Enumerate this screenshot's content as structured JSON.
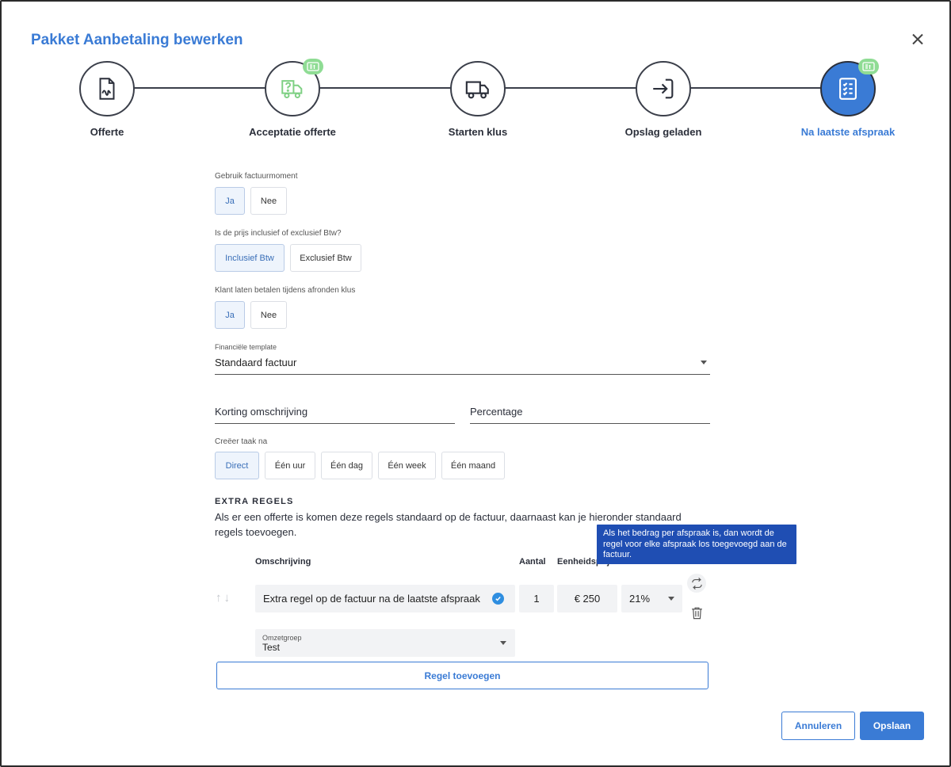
{
  "dialog": {
    "title": "Pakket Aanbetaling bewerken"
  },
  "steps": [
    {
      "label": "Offerte",
      "icon": "document-icon",
      "badge": false,
      "active": false
    },
    {
      "label": "Acceptatie offerte",
      "icon": "truck-question-icon",
      "badge": true,
      "active": false
    },
    {
      "label": "Starten klus",
      "icon": "truck-icon",
      "badge": false,
      "active": false
    },
    {
      "label": "Opslag geladen",
      "icon": "login-arrow-icon",
      "badge": false,
      "active": false
    },
    {
      "label": "Na laatste afspraak",
      "icon": "checklist-icon",
      "badge": true,
      "active": true
    }
  ],
  "form": {
    "factuurmoment": {
      "label": "Gebruik factuurmoment",
      "options": [
        "Ja",
        "Nee"
      ],
      "selected": "Ja"
    },
    "btw": {
      "label": "Is de prijs inclusief of exclusief Btw?",
      "options": [
        "Inclusief Btw",
        "Exclusief Btw"
      ],
      "selected": "Inclusief Btw"
    },
    "betalen": {
      "label": "Klant laten betalen tijdens afronden klus",
      "options": [
        "Ja",
        "Nee"
      ],
      "selected": "Ja"
    },
    "template": {
      "label": "Financiële template",
      "value": "Standaard factuur"
    },
    "korting": {
      "placeholder": "Korting omschrijving"
    },
    "percentage": {
      "placeholder": "Percentage"
    },
    "taak": {
      "label": "Creëer taak na",
      "options": [
        "Direct",
        "Één uur",
        "Één dag",
        "Één week",
        "Één maand"
      ],
      "selected": "Direct"
    }
  },
  "extra": {
    "title": "EXTRA REGELS",
    "description": "Als er een offerte is komen deze regels standaard op de factuur, daarnaast kan je hieronder standaard regels toevoegen.",
    "tooltip": "Als het bedrag per afspraak is, dan wordt de regel voor elke afspraak los toegevoegd aan de factuur.",
    "headers": {
      "omschrijving": "Omschrijving",
      "aantal": "Aantal",
      "eenheidsprijs": "Eenheidsprijs"
    },
    "row": {
      "omschrijving": "Extra regel op de factuur na de laatste afspraak",
      "aantal": "1",
      "prijs": "€ 250",
      "btw": "21%",
      "arrows": "↑↓",
      "omzetgroep_label": "Omzetgroep",
      "omzetgroep_value": "Test"
    },
    "add_label": "Regel toevoegen"
  },
  "footer": {
    "cancel": "Annuleren",
    "save": "Opslaan"
  },
  "colors": {
    "accent": "#3a7bd5",
    "badge": "#8fdc94",
    "tooltip": "#1f4eb3"
  }
}
